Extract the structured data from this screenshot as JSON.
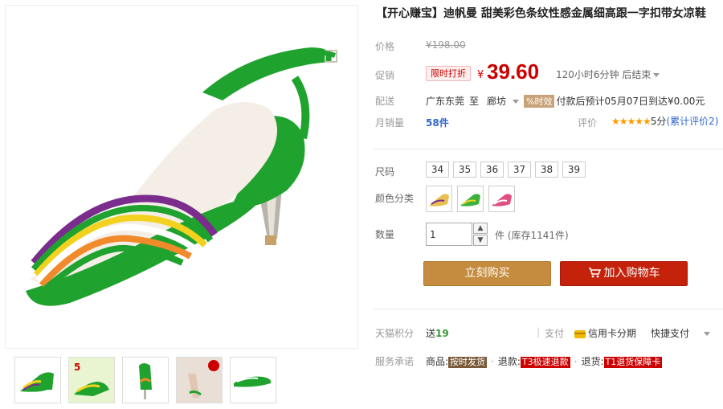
{
  "product": {
    "title": "【开心赚宝】迪帆曼 甜美彩色条纹性感金属细高跟一字扣带女凉鞋"
  },
  "price": {
    "label": "价格",
    "original": "¥198.00"
  },
  "promo": {
    "label": "促销",
    "tag": "限时打折",
    "currency": "¥",
    "value": "39.60",
    "countdown": "120小时6分钟 后结束"
  },
  "delivery": {
    "label": "配送",
    "from": "广东东莞",
    "to_word": "至",
    "to": "廊坊",
    "timely_tag": "时效",
    "info": "付款后预计05月07日到达¥0.00元"
  },
  "sales": {
    "label": "月销量",
    "value": "58件",
    "rating_label": "评价",
    "stars": "★★★★★",
    "rating_value": "5分",
    "reviews": "(累计评价2)"
  },
  "size": {
    "label": "尺码",
    "options": [
      "34",
      "35",
      "36",
      "37",
      "38",
      "39"
    ]
  },
  "color": {
    "label": "颜色分类",
    "swatches": [
      "#e8c050",
      "#3cb13c",
      "#e05080"
    ]
  },
  "quantity": {
    "label": "数量",
    "value": "1",
    "stock": "件 (库存1141件)"
  },
  "buttons": {
    "buy": "立刻购买",
    "cart": "加入购物车"
  },
  "points": {
    "label": "天猫积分",
    "prefix": "送",
    "value": "19",
    "pay_label": "支付",
    "card_pay": "信用卡分期",
    "quick_pay": "快捷支付"
  },
  "service": {
    "label": "服务承诺",
    "goods_label": "商品:",
    "goods_tag": "按时发货",
    "refund_label": "退款:",
    "refund_tag": "T3极速退款",
    "return_label": "退货:",
    "return_tag": "T1退货保障卡"
  },
  "colors": {
    "accent_red": "#cc0000",
    "buy_btn": "#c58b3e",
    "cart_btn": "#c4220b",
    "shoe_green": "#1fa22e"
  }
}
